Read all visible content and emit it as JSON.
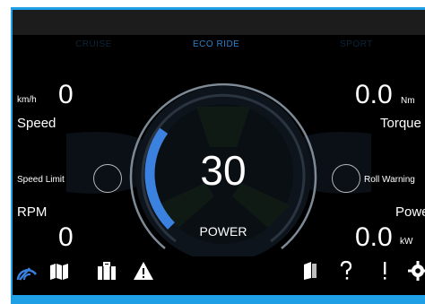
{
  "modes": {
    "left": "CRUISE",
    "center": "ECO RIDE",
    "right": "SPORT"
  },
  "speed": {
    "unit": "km/h",
    "value": "0",
    "label": "Speed"
  },
  "torque": {
    "value": "0.0",
    "unit": "Nm",
    "label": "Torque"
  },
  "speed_limit": {
    "label": "Speed Limit"
  },
  "roll_warning": {
    "label": "Roll Warning"
  },
  "rpm": {
    "label": "RPM",
    "value": "0"
  },
  "power_kw": {
    "label": "Power",
    "value": "0.0",
    "unit": "kW"
  },
  "gauge": {
    "value": "30",
    "label": "POWER",
    "level": 0.3
  },
  "colors": {
    "accent": "#3b82e0",
    "frame": "#1fa0e6",
    "background": "#000000"
  },
  "nav_icons": [
    "gauge-icon",
    "map-icon",
    "briefcase-icon",
    "warning-icon",
    "book-icon",
    "help-icon",
    "alert-icon",
    "gear-icon"
  ]
}
